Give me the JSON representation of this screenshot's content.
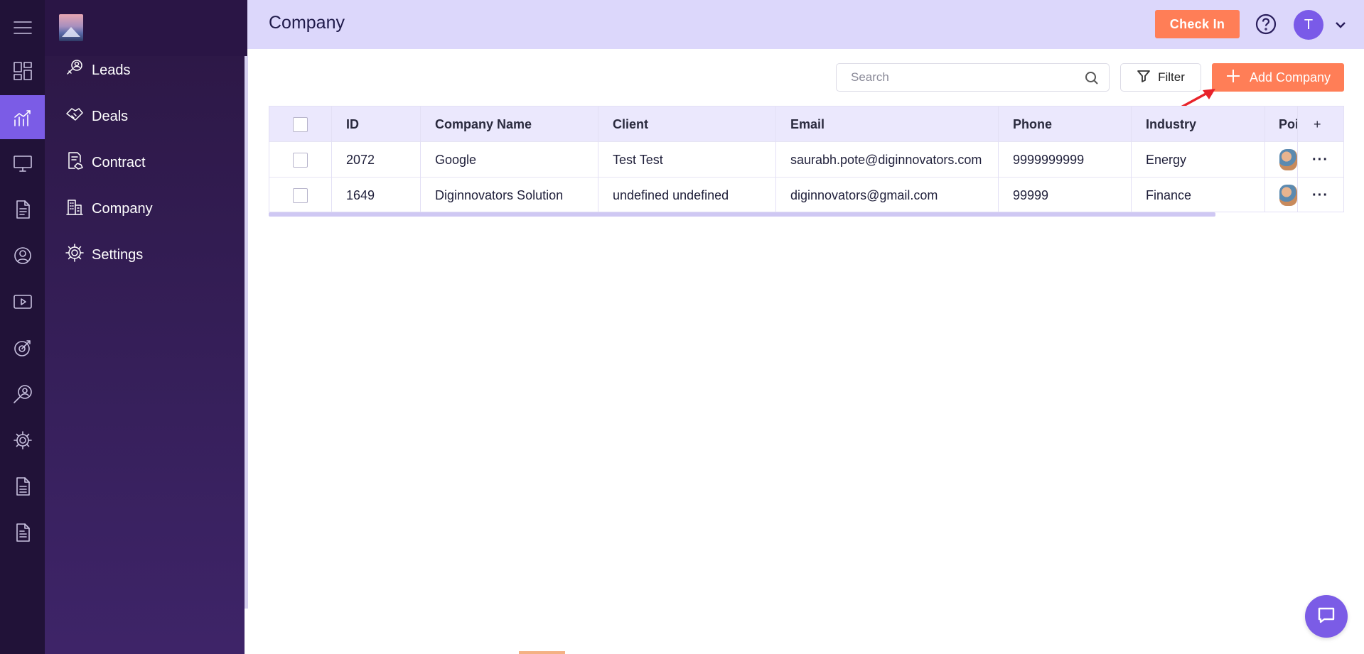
{
  "app": {
    "page_title": "Company"
  },
  "header": {
    "checkin_label": "Check In",
    "user_initial": "T"
  },
  "nav": {
    "items": [
      {
        "label": "Leads",
        "icon": "leads-icon"
      },
      {
        "label": "Deals",
        "icon": "handshake-icon"
      },
      {
        "label": "Contract",
        "icon": "contract-icon"
      },
      {
        "label": "Company",
        "icon": "building-icon"
      },
      {
        "label": "Settings",
        "icon": "gear-icon"
      }
    ]
  },
  "rail": {
    "icons": [
      "menu-icon",
      "dashboard-icon",
      "analytics-icon",
      "monitor-icon",
      "document-icon",
      "team-icon",
      "video-icon",
      "target-icon",
      "recruit-search-icon",
      "gear-icon",
      "report-icon",
      "invoice-icon"
    ],
    "active": "analytics-icon"
  },
  "toolbar": {
    "search_placeholder": "Search",
    "filter_label": "Filter",
    "add_label": "Add Company"
  },
  "table": {
    "columns": [
      "ID",
      "Company Name",
      "Client",
      "Email",
      "Phone",
      "Industry",
      "Poi"
    ],
    "rows": [
      {
        "id": "2072",
        "company": "Google",
        "client": "Test Test",
        "email": "saurabh.pote@diginnovators.com",
        "phone": "9999999999",
        "industry": "Energy"
      },
      {
        "id": "1649",
        "company": "Diginnovators Solution",
        "client": "undefined undefined",
        "email": "diginnovators@gmail.com",
        "phone": "99999",
        "industry": "Finance"
      }
    ]
  },
  "colors": {
    "accent": "#ff7e57",
    "primary": "#7b5ce6",
    "rail_bg": "#211238",
    "panel_bg": "#2d1847",
    "header_bg": "#dcd7fb",
    "annotation_arrow": "#e8232a"
  }
}
